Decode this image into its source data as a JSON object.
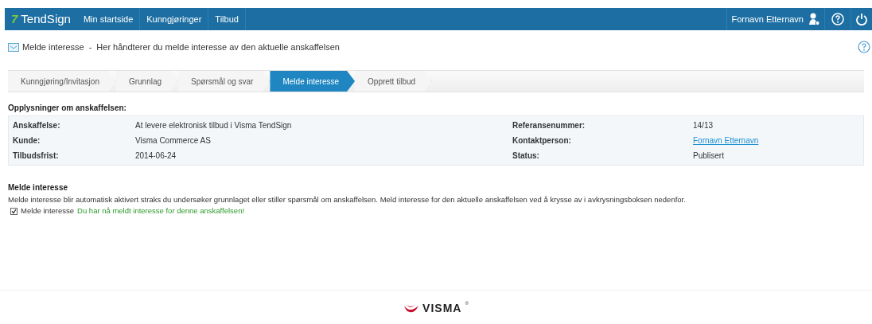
{
  "navbar": {
    "logo_mark": "7",
    "logo": "TendSign",
    "menu": [
      {
        "label": "Min startside"
      },
      {
        "label": "Kunngjøringer"
      },
      {
        "label": "Tilbud"
      }
    ],
    "user": "Fornavn Etternavn"
  },
  "page_title": {
    "title": "Melde interesse",
    "separator": "-",
    "subtitle": "Her håndterer du melde interesse av den aktuelle anskaffelsen"
  },
  "steps": [
    {
      "label": "Kunngjøring/Invitasjon",
      "selected": false
    },
    {
      "label": "Grunnlag",
      "selected": false
    },
    {
      "label": "Spørsmål og svar",
      "selected": false
    },
    {
      "label": "Melde interesse",
      "selected": true
    },
    {
      "label": "Opprett tilbud",
      "selected": false
    }
  ],
  "info": {
    "heading": "Opplysninger om anskaffelsen:",
    "rows": [
      {
        "label": "Anskaffelse:",
        "value": "At levere elektronisk tilbud i Visma TendSign",
        "label_2": "Referansenummer:",
        "value_2": "14/13",
        "kind": "text"
      },
      {
        "label": "Kunde:",
        "value": "Visma Commerce AS",
        "label_2": "Kontaktperson:",
        "value_2": "Fornavn Etternavn",
        "kind": "link"
      },
      {
        "label": "Tilbudsfrist:",
        "value": "2014-06-24",
        "label_2": "Status:",
        "value_2": "Publisert",
        "kind": "text"
      }
    ]
  },
  "interest": {
    "heading": "Melde interesse",
    "text": "Melde interesse blir automatisk aktivert straks du undersøker grunnlaget eller stiller spørsmål om anskaffelsen. Meld interesse for den aktuelle anskaffelsen ved å krysse av i avkrysningsboksen nedenfor.",
    "checkbox": {
      "label": "Melde interesse",
      "checked": true
    },
    "confirmation": "Du har nå meldt interesse for denne anskaffelsen!"
  },
  "footer": {
    "logo": "VISMA",
    "logo_mark": "®"
  }
}
